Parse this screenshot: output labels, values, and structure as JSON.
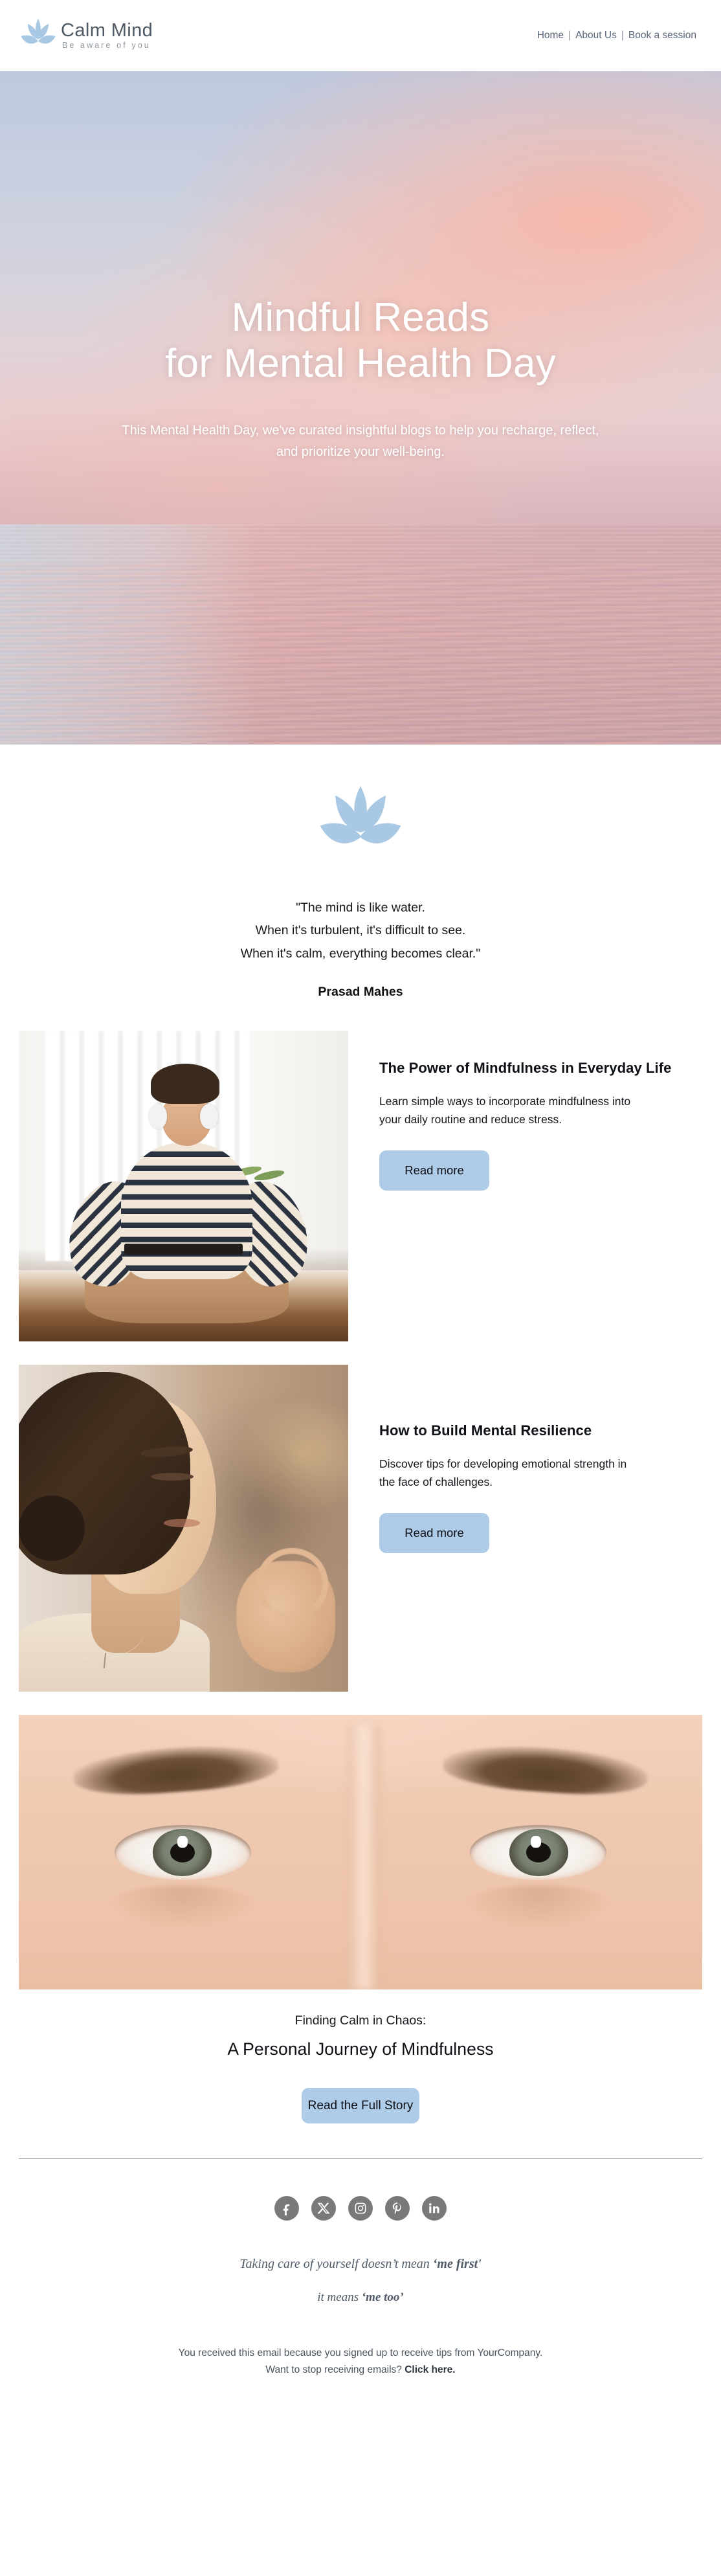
{
  "brand": {
    "name": "Calm Mind",
    "tagline": "Be aware of you",
    "logo_icon": "lotus-icon",
    "accent_color": "#aecbe7",
    "petal_color": "#a9c8e4"
  },
  "nav": {
    "items": [
      {
        "label": "Home"
      },
      {
        "label": "About Us"
      },
      {
        "label": "Book a session"
      }
    ],
    "separator": "|"
  },
  "hero": {
    "title_line1": "Mindful Reads",
    "title_line2": "for Mental Health Day",
    "subtitle": "This Mental Health Day, we've curated insightful blogs to help you recharge, reflect, and prioritize your well-being.",
    "background": "sunset-sky-over-water-photo"
  },
  "quote": {
    "icon": "lotus-icon",
    "line1": "\"The mind is like water.",
    "line2": "When it's turbulent, it's difficult to see.",
    "line3": "When it's calm, everything becomes clear.\"",
    "author": "Prasad Mahes"
  },
  "cards": [
    {
      "image_alt": "woman-meditating-with-headphones-photo",
      "title": "The Power of Mindfulness in Everyday Life",
      "description": "Learn simple ways to incorporate mindfulness into your daily routine and reduce stress.",
      "button_label": "Read more"
    },
    {
      "image_alt": "woman-meditating-profile-photo",
      "title": "How to Build Mental Resilience",
      "description": "Discover tips for developing emotional strength in the face of challenges.",
      "button_label": "Read more"
    }
  ],
  "feature": {
    "image_alt": "close-up-of-eyes-photo",
    "kicker": "Finding Calm in Chaos:",
    "title": "A Personal Journey of Mindfulness",
    "button_label": "Read the Full Story"
  },
  "footer": {
    "social": [
      {
        "name": "facebook-icon",
        "label": "Facebook"
      },
      {
        "name": "x-icon",
        "label": "X"
      },
      {
        "name": "instagram-icon",
        "label": "Instagram"
      },
      {
        "name": "pinterest-icon",
        "label": "Pinterest"
      },
      {
        "name": "linkedin-icon",
        "label": "LinkedIn"
      }
    ],
    "social_bg_color": "#797979",
    "tagline_line1_plain": "Taking care of yourself doesn’t mean ",
    "tagline_line1_bold": "‘me first'",
    "tagline_line2_plain": "it means ",
    "tagline_line2_bold": "‘me too’",
    "legal_line1": "You received this email because you signed up to receive tips from YourCompany.",
    "legal_line2_plain": "Want to stop receiving emails? ",
    "legal_line2_link": "Click here."
  }
}
